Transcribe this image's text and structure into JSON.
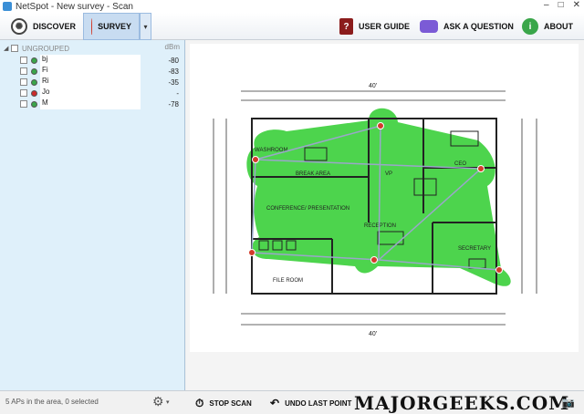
{
  "window": {
    "title": "NetSpot - New survey - Scan"
  },
  "toolbar": {
    "discover_label": "DISCOVER",
    "survey_label": "SURVEY",
    "user_guide_label": "USER GUIDE",
    "ask_question_label": "ASK A QUESTION",
    "about_label": "ABOUT"
  },
  "sidebar": {
    "group_label": "UNGROUPED",
    "signal_header": "dBm",
    "access_points": [
      {
        "name": "bj",
        "signal": "-80",
        "status_color": "#3aa64a"
      },
      {
        "name": "Fi",
        "signal": "-83",
        "status_color": "#3aa64a"
      },
      {
        "name": "Ri",
        "signal": "-35",
        "status_color": "#3aa64a"
      },
      {
        "name": "Jo",
        "signal": "-",
        "status_color": "#cc2b2b"
      },
      {
        "name": "M",
        "signal": "-78",
        "status_color": "#3aa64a"
      }
    ]
  },
  "statusbar": {
    "ap_summary": "5 APs in the area, 0 selected",
    "stop_scan_label": "STOP SCAN",
    "undo_label": "UNDO LAST POINT",
    "watermark": "MAJORGEEKS.COM"
  },
  "floorplan": {
    "rooms": {
      "washroom": "WASHROOM",
      "break_area": "BREAK AREA",
      "vp": "VP",
      "ceo": "CEO",
      "conference": "CONFERENCE/ PRESENTATION",
      "reception": "RECEPTION",
      "secretary": "SECRETARY",
      "file_room": "FILE ROOM"
    },
    "dimensions": {
      "top_width": "40'",
      "bottom_width": "40'"
    },
    "coverage_color": "#2ecc2e"
  }
}
